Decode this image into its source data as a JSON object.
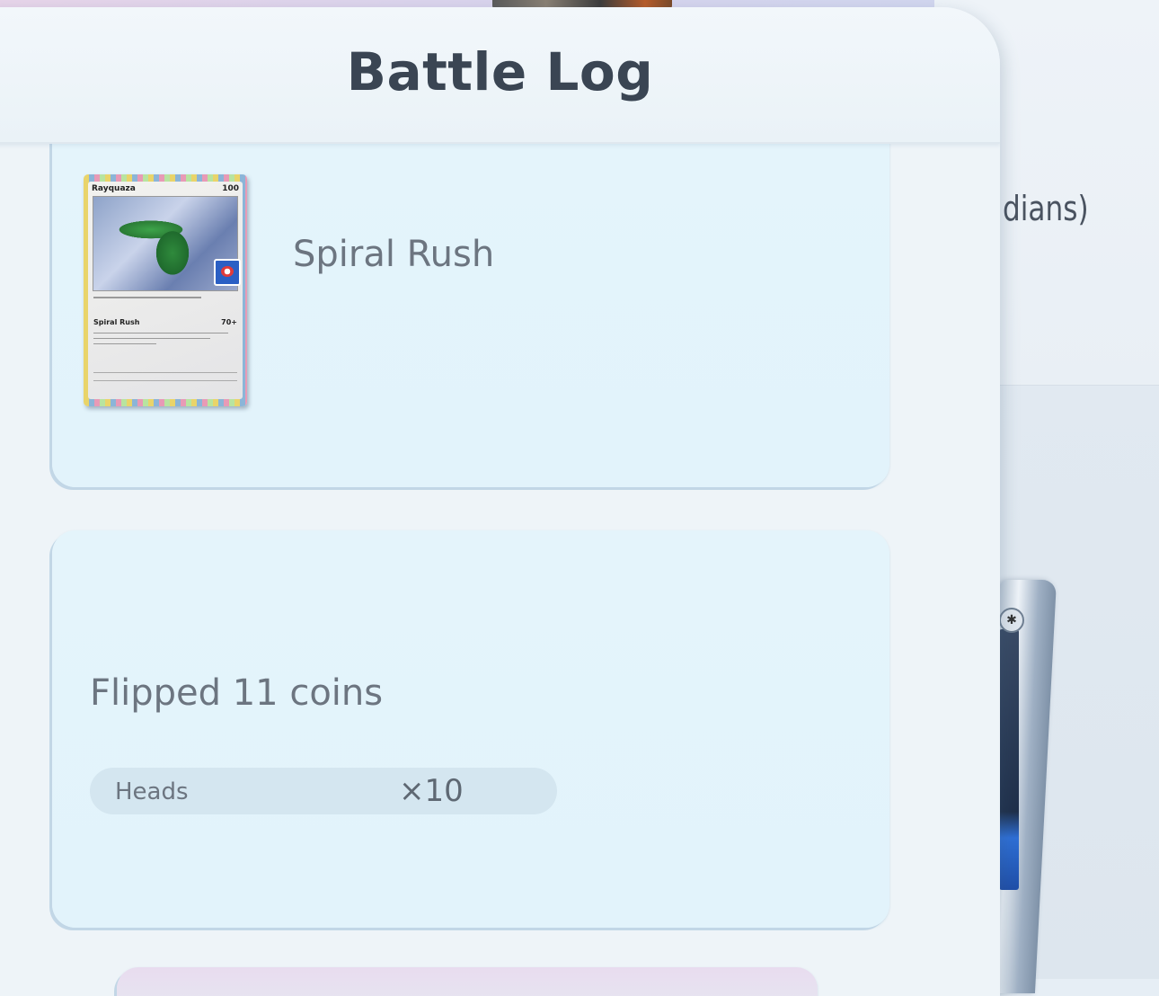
{
  "background": {
    "partial_text": "dians)"
  },
  "panel": {
    "title": "Battle Log"
  },
  "entries": [
    {
      "type": "attack",
      "card": {
        "name": "Rayquaza",
        "hp": "100",
        "attack_name": "Spiral Rush",
        "attack_damage": "70+"
      },
      "attack_label": "Spiral Rush"
    },
    {
      "type": "coin_flip",
      "summary": "Flipped 11 coins",
      "result": {
        "label": "Heads",
        "count": "×10"
      }
    }
  ]
}
